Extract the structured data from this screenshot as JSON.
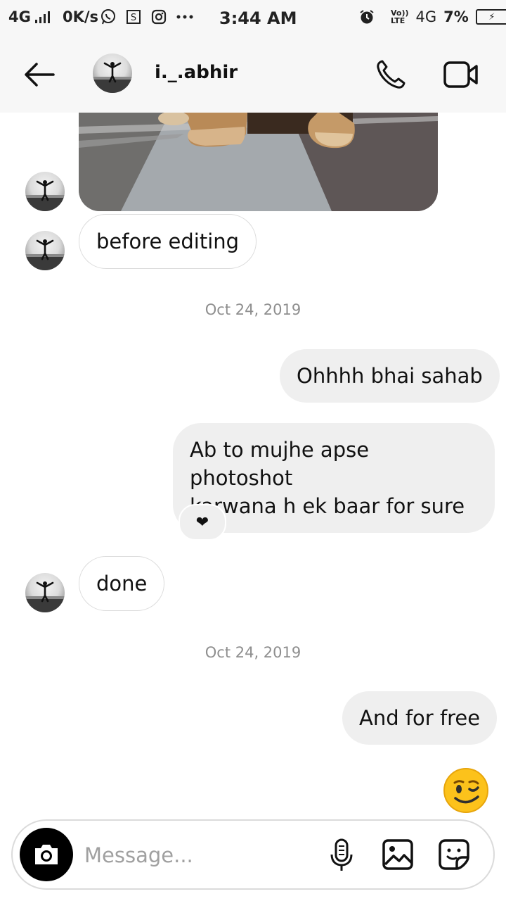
{
  "status_bar": {
    "network": "4G",
    "speed": "0K/s",
    "time": "3:44 AM",
    "volte_line1": "Vo))",
    "volte_line2": "LTE",
    "network_right": "4G",
    "battery_percent": "7%",
    "icons": [
      "signal-bars-icon",
      "whatsapp-icon",
      "screenshot-icon",
      "instagram-icon",
      "more-dots-icon",
      "alarm-icon",
      "battery-icon"
    ]
  },
  "header": {
    "username": "i._.abhir",
    "icons": [
      "back-arrow-icon",
      "phone-icon",
      "video-camera-icon"
    ]
  },
  "messages": {
    "before_editing": "before editing",
    "date_1": "Oct 24, 2019",
    "ohhhh": "Ohhhh bhai sahab",
    "photoshoot_line1": "Ab to mujhe apse photoshot",
    "photoshoot_line2": "karwana h ek baar for sure",
    "reaction": "❤",
    "done": "done",
    "date_2": "Oct 24, 2019",
    "for_free": "And for free"
  },
  "composer": {
    "placeholder": "Message...",
    "icons": [
      "camera-icon",
      "microphone-icon",
      "gallery-icon",
      "sticker-icon"
    ]
  },
  "colors": {
    "header_bg": "#f7f7f7",
    "bubble_out": "#efefef",
    "bubble_in_border": "#dbdbdb",
    "date_text": "#8e8e8e",
    "emoji_yellow": "#fcc21b"
  }
}
